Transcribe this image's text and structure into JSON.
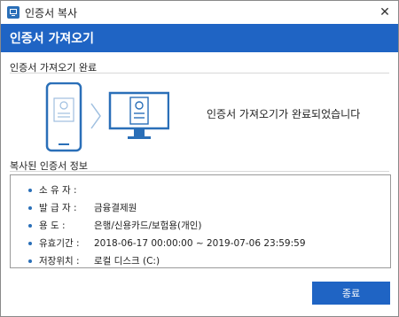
{
  "window": {
    "title": "인증서 복사",
    "close_glyph": "✕"
  },
  "header": {
    "title": "인증서 가져오기"
  },
  "status_section": {
    "label": "인증서 가져오기 완료",
    "message": "인증서 가져오기가 완료되었습니다"
  },
  "info_section": {
    "label": "복사된 인증서 정보",
    "rows": [
      {
        "label": "소 유 자 :",
        "value": ""
      },
      {
        "label": "발 급 자 :",
        "value": "금융결제원"
      },
      {
        "label": "용 도 :",
        "value": "은행/신용카드/보험용(개인)"
      },
      {
        "label": "유효기간 :",
        "value": "2018-06-17 00:00:00 ~ 2019-07-06 23:59:59"
      },
      {
        "label": "저장위치 :",
        "value": "로컬 디스크 (C:)"
      }
    ]
  },
  "footer": {
    "close_label": "종료"
  },
  "colors": {
    "accent": "#1f64c4",
    "illustration": "#2a6fb8"
  },
  "icons": [
    "certificate-app-icon",
    "close-icon",
    "phone-certificate-icon",
    "arrow-right-icon",
    "monitor-certificate-icon",
    "bullet-icon"
  ]
}
